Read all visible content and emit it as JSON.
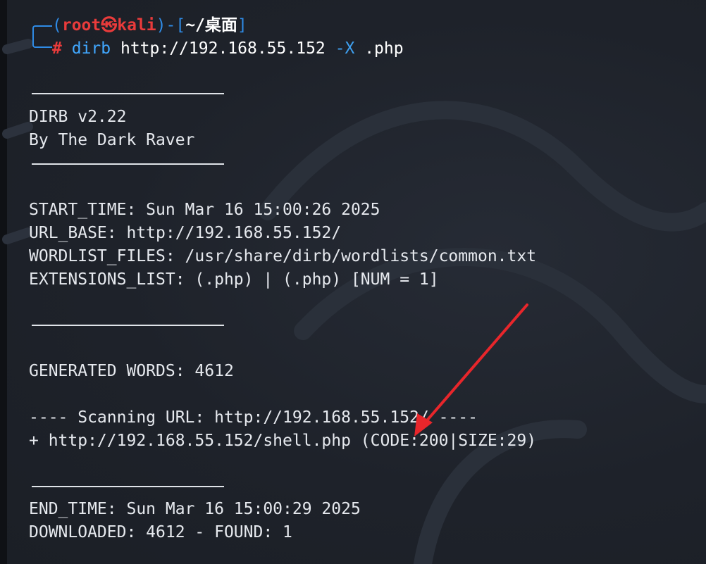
{
  "prompt": {
    "user": "root",
    "at_symbol": "㉿",
    "host": "kali",
    "path": "~/桌面",
    "hash": "#",
    "command": "dirb",
    "url": "http://192.168.55.152",
    "flag": "-X",
    "ext": ".php"
  },
  "banner": {
    "title": "DIRB v2.22",
    "author": "By The Dark Raver"
  },
  "info": {
    "start_time": "START_TIME: Sun Mar 16 15:00:26 2025",
    "url_base": "URL_BASE: http://192.168.55.152/",
    "wordlist": "WORDLIST_FILES: /usr/share/dirb/wordlists/common.txt",
    "extensions": "EXTENSIONS_LIST: (.php) | (.php) [NUM = 1]"
  },
  "generated": "GENERATED WORDS: 4612",
  "scan": {
    "header": "---- Scanning URL: http://192.168.55.152/ ----",
    "result": "+ http://192.168.55.152/shell.php (CODE:200|SIZE:29)"
  },
  "end": {
    "end_time": "END_TIME: Sun Mar 16 15:00:29 2025",
    "downloaded": "DOWNLOADED: 4612 - FOUND: 1"
  },
  "colors": {
    "background": "#1f232b",
    "text": "#e6e9ee",
    "prompt_red": "#e93b3b",
    "prompt_blue": "#2f8be6",
    "annotation_arrow": "#e8262b"
  }
}
